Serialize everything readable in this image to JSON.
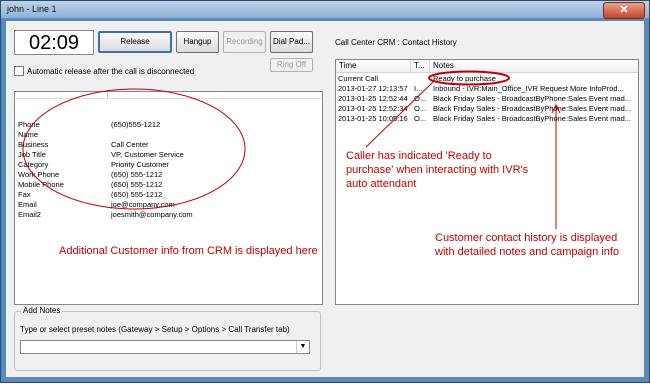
{
  "window": {
    "title": "john - Line 1",
    "close_glyph": "✕"
  },
  "toolbar": {
    "timer": "02:09",
    "release": "Release",
    "hangup": "Hangup",
    "recording": "Recording",
    "dialpad": "Dial Pad...",
    "ringoff": "Ring Off"
  },
  "auto_release": {
    "label": "Automatic release after the call is disconnected",
    "checked": false
  },
  "customer_info": [
    {
      "key": "Phone",
      "value": "(650)555-1212"
    },
    {
      "key": "Name",
      "value": ""
    },
    {
      "key": "Business",
      "value": "Call Center"
    },
    {
      "key": "Job Title",
      "value": "VP, Customer Service"
    },
    {
      "key": "Category",
      "value": "Priority Customer"
    },
    {
      "key": "Work Phone",
      "value": "(650) 555-1212"
    },
    {
      "key": "Mobile Phone",
      "value": "(650) 555-1212"
    },
    {
      "key": "Fax",
      "value": "(650) 555-1212"
    },
    {
      "key": "Email",
      "value": "joe@company.com"
    },
    {
      "key": "Email2",
      "value": "joesmith@company.com"
    }
  ],
  "add_notes": {
    "legend": "Add Notes",
    "hint": "Type or select preset notes (Gateway > Setup > Options > Call Transfer tab)",
    "value": "",
    "arrow_icon": "▼"
  },
  "crm": {
    "title": "Call Center CRM : Contact History",
    "columns": [
      "Time",
      "T...",
      "Notes"
    ],
    "rows": [
      {
        "time": "Current Call",
        "type": "",
        "notes": "Ready to purchase"
      },
      {
        "time": "2013-01-27 12:13:57",
        "type": "I...",
        "notes": "Inbound - IVR:Main_Office_IVR Request More InfoProd..."
      },
      {
        "time": "2013-01-25 12:52:44",
        "type": "O...",
        "notes": "Black Friday Sales - BroadcastByPhone:Sales Event mad..."
      },
      {
        "time": "2013-01-25 12:52:34",
        "type": "O...",
        "notes": "Black Friday Sales - BroadcastByPhone:Sales Event mad..."
      },
      {
        "time": "2013-01-25 10:05:16",
        "type": "O...",
        "notes": "Black Friday Sales - BroadcastByPhone:Sales Event mad..."
      }
    ]
  },
  "annotations": {
    "customer_info": "Additional Customer info from CRM is displayed here",
    "ready": "Caller has indicated 'Ready to purchase' when interacting with IVR's auto attendant",
    "history": "Customer contact history is displayed with detailed notes and campaign info"
  },
  "colors": {
    "annotation": "#c00000",
    "accent": "#3a6fb0"
  }
}
